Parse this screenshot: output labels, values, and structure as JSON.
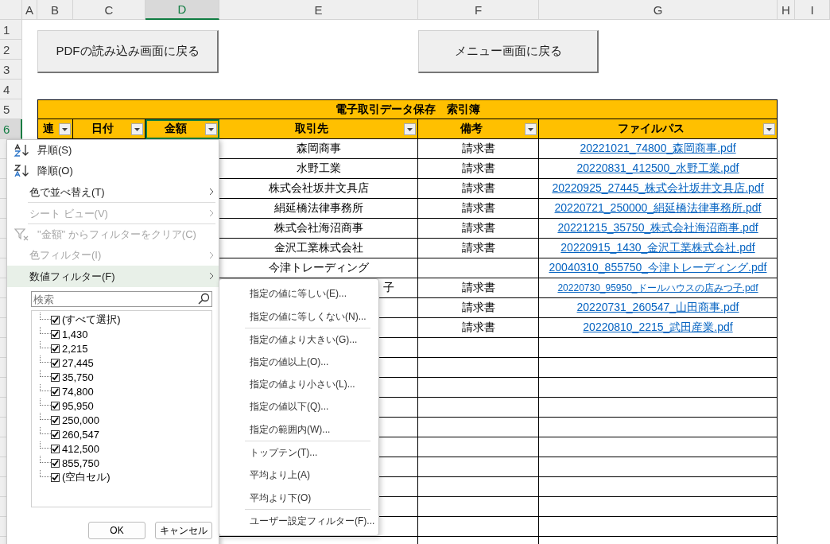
{
  "column_headers": [
    {
      "label": "A",
      "selected": false
    },
    {
      "label": "B",
      "selected": false
    },
    {
      "label": "C",
      "selected": false
    },
    {
      "label": "D",
      "selected": true
    },
    {
      "label": "E",
      "selected": false
    },
    {
      "label": "F",
      "selected": false
    },
    {
      "label": "G",
      "selected": false
    },
    {
      "label": "H",
      "selected": false
    },
    {
      "label": "I",
      "selected": false
    }
  ],
  "row_numbers": [
    "1",
    "2",
    "3",
    "4",
    "5",
    "6"
  ],
  "buttons": [
    {
      "label": "PDFの読み込み画面に戻る"
    },
    {
      "label": "メニュー画面に戻る"
    }
  ],
  "table": {
    "title": "電子取引データ保存　索引簿",
    "headers": [
      {
        "label": "連",
        "selected": false
      },
      {
        "label": "日付",
        "selected": false
      },
      {
        "label": "金額",
        "selected": true
      },
      {
        "label": "取引先",
        "selected": false
      },
      {
        "label": "備考",
        "selected": false
      },
      {
        "label": "ファイルパス",
        "selected": false
      }
    ],
    "rows": [
      {
        "partner": "森岡商事",
        "note": "請求書",
        "file": "20221021_74800_森岡商事.pdf"
      },
      {
        "partner": "水野工業",
        "note": "請求書",
        "file": "20220831_412500_水野工業.pdf"
      },
      {
        "partner": "株式会社坂井文具店",
        "note": "請求書",
        "file": "20220925_27445_株式会社坂井文具店.pdf"
      },
      {
        "partner": "絹延橋法律事務所",
        "note": "請求書",
        "file": "20220721_250000_絹延橋法律事務所.pdf"
      },
      {
        "partner": "株式会社海沼商事",
        "note": "請求書",
        "file": "20221215_35750_株式会社海沼商事.pdf"
      },
      {
        "partner": "金沢工業株式会社",
        "note": "請求書",
        "file": "20220915_1430_金沢工業株式会社.pdf"
      },
      {
        "partner": "今津トレーディング",
        "file": "20040310_855750_今津トレーディング.pdf"
      },
      {
        "partner": "子",
        "partner_tail": true,
        "note": "請求書",
        "file": "20220730_95950_ドールハウスの店みつ子.pdf",
        "shrink": true
      },
      {
        "note": "請求書",
        "file": "20220731_260547_山田商事.pdf"
      },
      {
        "note": "請求書",
        "file": "20220810_2215_武田産業.pdf"
      }
    ]
  },
  "filter_menu": {
    "items": [
      {
        "kind": "sort-asc",
        "label": "昇順(S)",
        "disabled": false,
        "selected": false,
        "submenu": false,
        "separator_after": false
      },
      {
        "kind": "sort-desc",
        "label": "降順(O)",
        "disabled": false,
        "selected": false,
        "submenu": false,
        "separator_after": false
      },
      {
        "kind": "plain",
        "label": "色で並べ替え(T)",
        "disabled": false,
        "selected": false,
        "submenu": true,
        "separator_after": true
      },
      {
        "kind": "plain",
        "label": "シート ビュー(V)",
        "disabled": true,
        "selected": false,
        "submenu": true,
        "separator_after": true
      },
      {
        "kind": "clear",
        "label": "\"金額\" からフィルターをクリア(C)",
        "disabled": true,
        "selected": false,
        "submenu": false,
        "separator_after": false
      },
      {
        "kind": "plain",
        "label": "色フィルター(I)",
        "disabled": true,
        "selected": false,
        "submenu": true,
        "separator_after": false
      },
      {
        "kind": "plain",
        "label": "数値フィルター(F)",
        "disabled": false,
        "selected": true,
        "submenu": true,
        "separator_after": true
      }
    ],
    "search": {
      "placeholder": "検索"
    },
    "values": [
      {
        "label": "(すべて選択)",
        "checked": true
      },
      {
        "label": "1,430",
        "checked": true
      },
      {
        "label": "2,215",
        "checked": true
      },
      {
        "label": "27,445",
        "checked": true
      },
      {
        "label": "35,750",
        "checked": true
      },
      {
        "label": "74,800",
        "checked": true
      },
      {
        "label": "95,950",
        "checked": true
      },
      {
        "label": "250,000",
        "checked": true
      },
      {
        "label": "260,547",
        "checked": true
      },
      {
        "label": "412,500",
        "checked": true
      },
      {
        "label": "855,750",
        "checked": true
      },
      {
        "label": "(空白セル)",
        "checked": true
      }
    ],
    "buttons": [
      "OK",
      "キャンセル"
    ]
  },
  "number_filter_menu": {
    "items": [
      {
        "label": "指定の値に等しい(E)...",
        "separator_after": false
      },
      {
        "label": "指定の値に等しくない(N)...",
        "separator_after": true
      },
      {
        "label": "指定の値より大きい(G)...",
        "separator_after": false
      },
      {
        "label": "指定の値以上(O)...",
        "separator_after": false
      },
      {
        "label": "指定の値より小さい(L)...",
        "separator_after": false
      },
      {
        "label": "指定の値以下(Q)...",
        "separator_after": false
      },
      {
        "label": "指定の範囲内(W)...",
        "separator_after": true
      },
      {
        "label": "トップテン(T)...",
        "separator_after": false
      },
      {
        "label": "平均より上(A)",
        "separator_after": false
      },
      {
        "label": "平均より下(O)",
        "separator_after": true
      },
      {
        "label": "ユーザー設定フィルター(F)...",
        "separator_after": false
      }
    ]
  }
}
